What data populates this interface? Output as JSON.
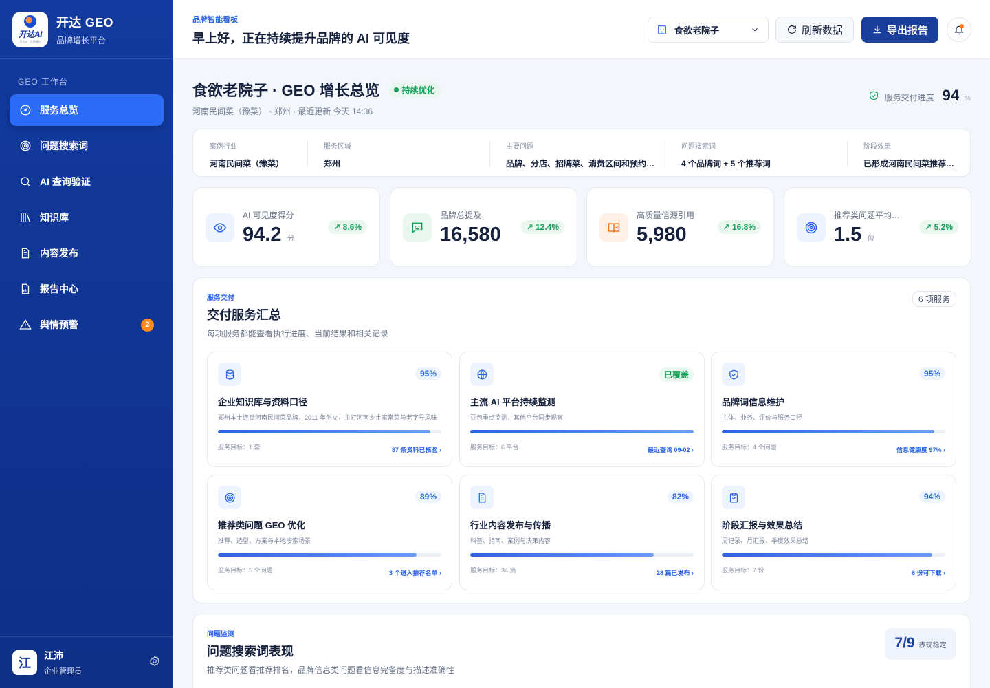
{
  "sidebar": {
    "brand_title": "开达 GEO",
    "brand_sub": "品牌增长平台",
    "logo_text": "开达AI",
    "logo_small": "开达AI · 品牌增长",
    "section_label": "GEO 工作台",
    "items": [
      {
        "label": "服务总览",
        "icon": "dashboard-icon",
        "active": true
      },
      {
        "label": "问题搜索词",
        "icon": "target-icon"
      },
      {
        "label": "AI 查询验证",
        "icon": "search-icon"
      },
      {
        "label": "知识库",
        "icon": "library-icon"
      },
      {
        "label": "内容发布",
        "icon": "document-icon"
      },
      {
        "label": "报告中心",
        "icon": "report-icon"
      },
      {
        "label": "舆情预警",
        "icon": "warning-icon",
        "badge": "2"
      }
    ],
    "user": {
      "avatar": "江",
      "name": "江沛",
      "role": "企业管理员"
    }
  },
  "header": {
    "kicker": "品牌智能看板",
    "title": "早上好，正在持续提升品牌的 AI 可见度",
    "store": "食欲老院子",
    "refresh_label": "刷新数据",
    "export_label": "导出报告"
  },
  "summary": {
    "title": "食欲老院子 · GEO 增长总览",
    "status": "持续优化",
    "meta": "河南民间菜（豫菜） · 郑州 · 最近更新 今天 14:36",
    "delivery_label": "服务交付进度",
    "delivery_value": "94",
    "delivery_unit": "%"
  },
  "info": [
    {
      "label": "案例行业",
      "value": "河南民间菜（豫菜）"
    },
    {
      "label": "服务区域",
      "value": "郑州"
    },
    {
      "label": "主要问题",
      "value": "品牌、分店、招牌菜、消费区间和预约信息"
    },
    {
      "label": "问题搜索词",
      "value": "4 个品牌词 + 5 个推荐词"
    },
    {
      "label": "阶段效果",
      "value": "已形成河南民间菜推荐结果"
    }
  ],
  "kpis": [
    {
      "label": "AI 可见度得分",
      "value": "94.2",
      "unit": "分",
      "change": "8.6%",
      "icon": "eye-icon"
    },
    {
      "label": "品牌总提及",
      "value": "16,580",
      "unit": "",
      "change": "12.4%",
      "icon": "message-icon"
    },
    {
      "label": "高质量信源引用",
      "value": "5,980",
      "unit": "",
      "change": "16.8%",
      "icon": "book-icon"
    },
    {
      "label": "推荐类问题平均排名",
      "value": "1.5",
      "unit": "位",
      "change": "5.2%",
      "icon": "target-icon"
    }
  ],
  "services_panel": {
    "kicker": "服务交付",
    "title": "交付服务汇总",
    "desc": "每项服务都能查看执行进度、当前结果和相关记录",
    "chip": "6 项服务",
    "items": [
      {
        "title": "企业知识库与资料口径",
        "desc": "郑州本土连锁河南民间菜品牌，2011 年创立，主打河南乡土家常菜与老字号风味",
        "badge": "95%",
        "progress": 0.95,
        "target": "服务目标：1 套",
        "link": "87 条资料已核验 ›",
        "icon": "database-icon"
      },
      {
        "title": "主流 AI 平台持续监测",
        "desc": "豆包重点监测，其他平台同步观察",
        "badge": "已覆盖",
        "progress": 1.0,
        "target": "服务目标：6 平台",
        "link": "最近查询 09-02 ›",
        "icon": "globe-icon"
      },
      {
        "title": "品牌词信息维护",
        "desc": "主体、业务、评价与服务口径",
        "badge": "95%",
        "progress": 0.95,
        "target": "服务目标：4 个问题",
        "link": "信息健康度 97% ›",
        "icon": "shield-icon"
      },
      {
        "title": "推荐类问题 GEO 优化",
        "desc": "推荐、选型、方案与本地搜索场景",
        "badge": "89%",
        "progress": 0.89,
        "target": "服务目标：5 个问题",
        "link": "3 个进入推荐名单 ›",
        "icon": "target-icon"
      },
      {
        "title": "行业内容发布与传播",
        "desc": "科普、指南、案例与决策内容",
        "badge": "82%",
        "progress": 0.82,
        "target": "服务目标：34 篇",
        "link": "28 篇已发布 ›",
        "icon": "document-icon"
      },
      {
        "title": "阶段汇报与效果总结",
        "desc": "周记录、月汇报、季度效果总结",
        "badge": "94%",
        "progress": 0.94,
        "target": "服务目标：7 份",
        "link": "6 份可下载 ›",
        "icon": "clipboard-icon"
      }
    ]
  },
  "query_panel": {
    "kicker": "问题监测",
    "title": "问题搜索词表现",
    "desc": "推荐类问题看推荐排名，品牌信息类问题看信息完备度与描述准确性",
    "rank_value": "7/9",
    "rank_label": "表现稳定"
  },
  "colors": {
    "sidebar": "#123aa0",
    "accent": "#2a64e8",
    "active": "#2a6cf6",
    "success": "#16a05a",
    "badge": "#ff8a1f"
  }
}
